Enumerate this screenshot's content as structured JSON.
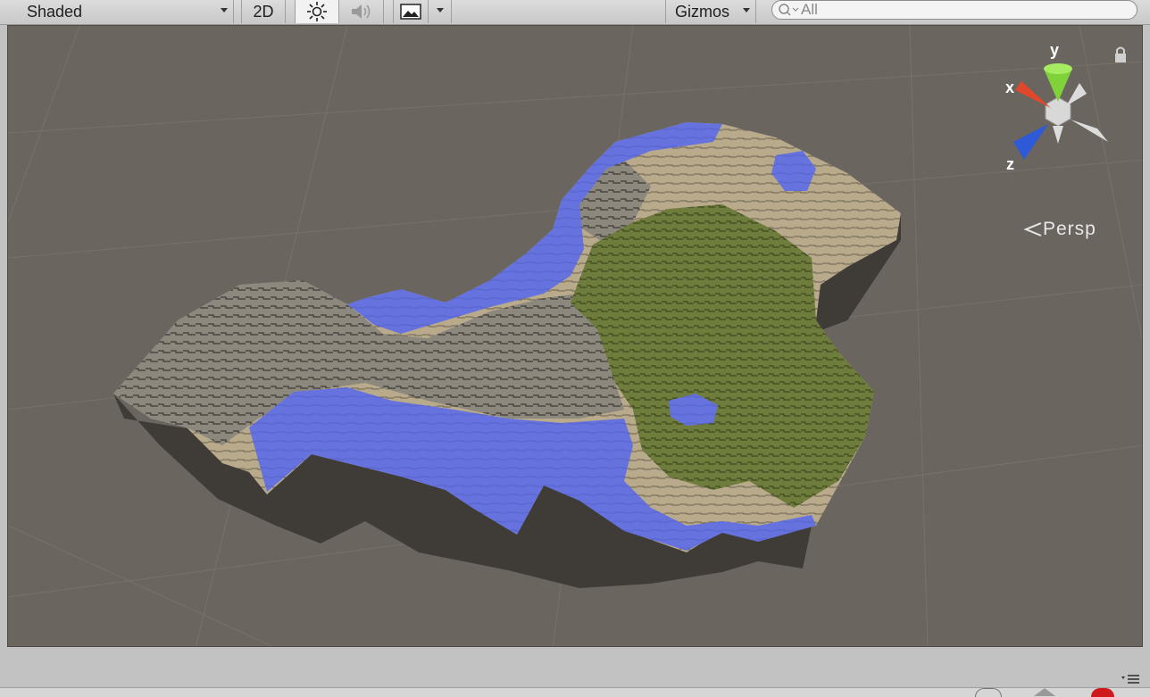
{
  "toolbar": {
    "draw_mode": "Shaded",
    "mode_2d": "2D",
    "gizmos": "Gizmos",
    "search_placeholder": "All"
  },
  "viewport": {
    "projection_label": "Persp",
    "axes": {
      "x": "x",
      "y": "y",
      "z": "z"
    }
  },
  "colors": {
    "background": "#6b6560",
    "water": "#6674e0",
    "sand": "#b6a88a",
    "rock": "#8f8a80",
    "grass": "#6f7d3e",
    "gizmo_x": "#e0472b",
    "gizmo_y": "#7fd23a",
    "gizmo_z": "#2e5ad8"
  },
  "icons": {
    "lighting": "sun-icon",
    "audio": "speaker-icon",
    "effects": "image-icon",
    "search": "search-icon",
    "lock": "lock-icon"
  }
}
